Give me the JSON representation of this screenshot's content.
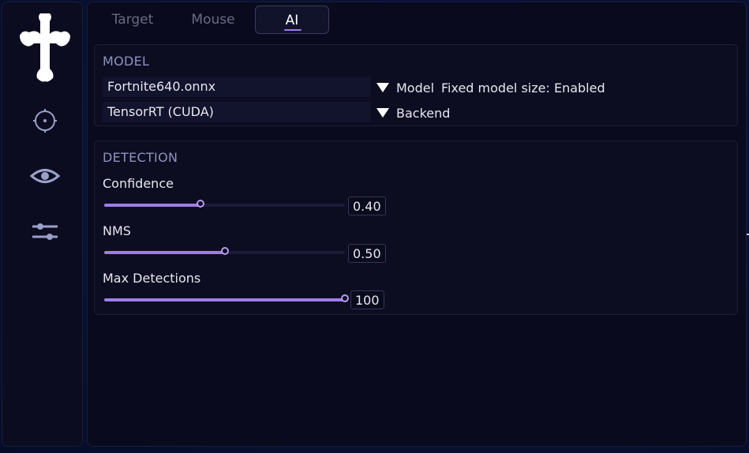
{
  "tabs": [
    {
      "label": "Target",
      "active": false
    },
    {
      "label": "Mouse",
      "active": false
    },
    {
      "label": "AI",
      "active": true
    }
  ],
  "sidebar": {
    "items": [
      {
        "icon": "crosshair-icon"
      },
      {
        "icon": "eye-icon"
      },
      {
        "icon": "sliders-icon"
      }
    ],
    "logo": "cross-logo"
  },
  "model": {
    "title": "MODEL",
    "model_file": "Fortnite640.onnx",
    "model_label": "Model",
    "fixed_size_text": "Fixed model size: Enabled",
    "backend_value": "TensorRT (CUDA)",
    "backend_label": "Backend"
  },
  "detection": {
    "title": "DETECTION",
    "sliders": [
      {
        "label": "Confidence",
        "value": "0.40",
        "fraction": 0.4
      },
      {
        "label": "NMS",
        "value": "0.50",
        "fraction": 0.5
      },
      {
        "label": "Max Detections",
        "value": "100",
        "fraction": 1.0
      }
    ]
  },
  "colors": {
    "accent": "#a07ce8",
    "background": "#091235",
    "panel": "#0c0d20"
  }
}
